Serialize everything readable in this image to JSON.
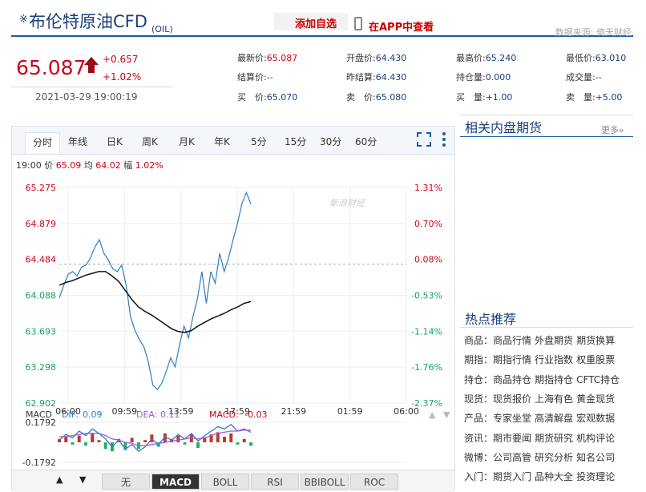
{
  "header": {
    "star": "※",
    "title": "布伦特原油CFD",
    "code": "(OIL)",
    "add_fav": "添加自选",
    "app_link": "在APP中查看",
    "source": "数据来源: 倚天财经"
  },
  "quote": {
    "price": "65.087",
    "change": "+0.657",
    "change_pct": "+1.02%",
    "timestamp": "2021-03-29 19:00:19",
    "fields": [
      {
        "label": "最新价:",
        "value": "65.087",
        "color": "red"
      },
      {
        "label": "开盘价:",
        "value": "64.430",
        "color": "blue"
      },
      {
        "label": "最高价:",
        "value": "65.240",
        "color": "blue"
      },
      {
        "label": "最低价:",
        "value": "63.010",
        "color": "blue"
      },
      {
        "label": "结算价:",
        "value": "--",
        "color": "blue"
      },
      {
        "label": "昨结算:",
        "value": "64.430",
        "color": "blue"
      },
      {
        "label": "持仓量:",
        "value": "0.000",
        "color": "blue"
      },
      {
        "label": "成交量:",
        "value": "--",
        "color": "blue"
      },
      {
        "label": "买　价:",
        "value": "65.070",
        "color": "blue"
      },
      {
        "label": "卖　价:",
        "value": "65.080",
        "color": "blue"
      },
      {
        "label": "买　量:",
        "value": "+1.00",
        "color": "blue"
      },
      {
        "label": "卖　量:",
        "value": "+5.00",
        "color": "blue"
      }
    ]
  },
  "tabs": [
    "分时",
    "年线",
    "日K",
    "周K",
    "月K",
    "年K",
    "5分",
    "15分",
    "30分",
    "60分"
  ],
  "active_tab": "分时",
  "info_line": {
    "time": "19:00",
    "price_label": "价",
    "price": "65.09",
    "avg_label": "均",
    "avg": "64.02",
    "amp_label": "幅",
    "amp": "1.02%"
  },
  "watermark": "新浪财经",
  "chart_data": {
    "type": "line",
    "y_ticks": [
      "65.275",
      "64.879",
      "64.484",
      "64.088",
      "63.693",
      "63.298",
      "62.902"
    ],
    "pct_ticks": [
      "1.31%",
      "0.70%",
      "0.08%",
      "-0.53%",
      "-1.14%",
      "-1.76%",
      "-2.37%"
    ],
    "x_ticks": [
      "06:00",
      "09:59",
      "13:59",
      "17:59",
      "21:59",
      "01:59",
      "06:00"
    ],
    "ylim": [
      62.902,
      65.275
    ],
    "prev_settle": 64.43,
    "series": [
      {
        "values": [
          64.06,
          64.2,
          64.32,
          64.35,
          64.3,
          64.4,
          64.42,
          64.5,
          64.62,
          64.7,
          64.55,
          64.48,
          64.38,
          64.35,
          64.42,
          64.2,
          63.85,
          63.7,
          63.6,
          63.52,
          63.35,
          63.1,
          63.05,
          63.12,
          63.25,
          63.4,
          63.3,
          63.55,
          63.75,
          63.62,
          63.85,
          64.05,
          64.35,
          64.0,
          64.35,
          64.22,
          64.55,
          64.35,
          64.5,
          64.7,
          64.88,
          65.1,
          65.22,
          65.09
        ],
        "color": "#2d7fc2"
      },
      {
        "values": [
          64.2,
          64.23,
          64.25,
          64.28,
          64.31,
          64.33,
          64.35,
          64.35,
          64.3,
          64.24,
          64.14,
          64.04,
          63.96,
          63.91,
          63.87,
          63.82,
          63.77,
          63.72,
          63.69,
          63.68,
          63.7,
          63.75,
          63.79,
          63.83,
          63.86,
          63.89,
          63.93,
          63.96,
          64.0,
          64.02
        ],
        "color": "#111111"
      }
    ]
  },
  "macd": {
    "label": "MACD",
    "dif_label": "DIF:",
    "dif": "0.09",
    "dea_label": "DEA:",
    "dea": "0.11",
    "macd_label": "MACD:",
    "macd": "-0.03",
    "top": "0.1792",
    "bottom": "-0.1792",
    "dif_values": [
      0.02,
      0.07,
      0.04,
      0.1,
      0.06,
      0.12,
      0.08,
      0.03,
      -0.04,
      0.02,
      -0.06,
      -0.02,
      -0.08,
      -0.04,
      0.03,
      -0.02,
      0.05,
      0.02,
      0.07,
      0.03,
      0.08,
      0.01,
      0.06,
      0.1,
      0.14,
      0.12,
      0.16,
      0.1,
      0.12,
      0.09
    ],
    "dea_values": [
      0.05,
      0.05,
      0.06,
      0.07,
      0.08,
      0.08,
      0.08,
      0.06,
      0.03,
      0.02,
      0.0,
      -0.01,
      -0.03,
      -0.03,
      -0.02,
      -0.01,
      0.0,
      0.01,
      0.02,
      0.03,
      0.04,
      0.03,
      0.04,
      0.06,
      0.08,
      0.09,
      0.1,
      0.1,
      0.11,
      0.11
    ],
    "bars": [
      0.03,
      0.05,
      -0.02,
      0.06,
      -0.03,
      0.08,
      0.02,
      -0.06,
      -0.08,
      0.03,
      -0.07,
      0.04,
      -0.06,
      0.02,
      0.07,
      -0.04,
      0.08,
      0.03,
      0.06,
      -0.02,
      0.07,
      -0.05,
      0.04,
      0.07,
      0.09,
      0.05,
      0.08,
      -0.02,
      0.03,
      -0.03
    ]
  },
  "indicators": [
    "无",
    "MACD",
    "BOLL",
    "RSI",
    "BBIBOLL",
    "ROC"
  ],
  "active_indicator": "MACD",
  "sidebar": {
    "related_title": "相关内盘期货",
    "more": "更多»",
    "hot_title": "热点推荐",
    "hot_rows": [
      {
        "cat": "商品",
        "links": [
          "商品行情",
          "外盘期货",
          "期货换算"
        ]
      },
      {
        "cat": "期指",
        "links": [
          "期指行情",
          "行业指数",
          "权重股票"
        ]
      },
      {
        "cat": "持仓",
        "links": [
          "商品持仓",
          "期指持仓",
          "CFTC持仓"
        ]
      },
      {
        "cat": "现货",
        "links": [
          "现货报价",
          "上海有色",
          "黄金现货"
        ]
      },
      {
        "cat": "产品",
        "links": [
          "专家坐堂",
          "高清解盘",
          "宏观数据"
        ]
      },
      {
        "cat": "资讯",
        "links": [
          "期市要闻",
          "期货研究",
          "机构评论"
        ]
      },
      {
        "cat": "微博",
        "links": [
          "公司高管",
          "研究分析",
          "知名公司"
        ]
      },
      {
        "cat": "入门",
        "links": [
          "期货入门",
          "品种大全",
          "投资理论"
        ]
      }
    ]
  },
  "colors": {
    "up": "#d0021b",
    "down": "#1aa260",
    "brand": "#1a3e7a",
    "price_line": "#2d7fc2",
    "avg_line": "#111111",
    "macd_up": "#c0392b",
    "macd_down": "#27ae60",
    "dif": "#2d7fc2",
    "dea": "#a259d9"
  }
}
